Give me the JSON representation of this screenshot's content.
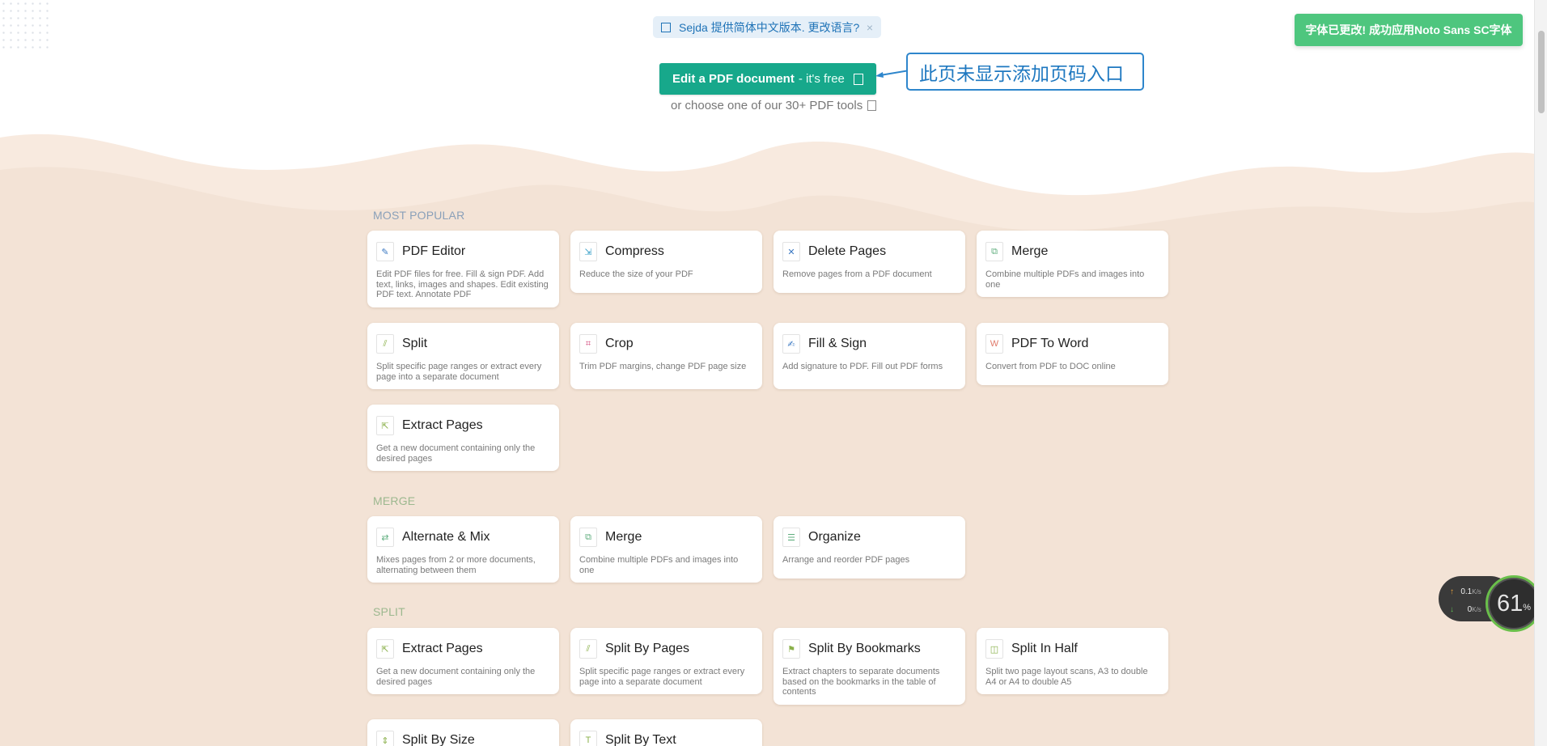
{
  "language_bar": {
    "text": "Sejda 提供简体中文版本. 更改语言?",
    "close": "×"
  },
  "toast": {
    "text": "字体已更改! 成功应用Noto Sans SC字体"
  },
  "hero": {
    "edit_button_bold": "Edit a PDF document",
    "edit_button_rest": "- it's free",
    "choose_text": "or choose one of our 30+ PDF tools"
  },
  "callout": {
    "text": "此页未显示添加页码入口"
  },
  "sections": {
    "popular": "MOST POPULAR",
    "merge": "MERGE",
    "split": "SPLIT"
  },
  "cards": {
    "pdf_editor": {
      "title": "PDF Editor",
      "desc": "Edit PDF files for free. Fill & sign PDF. Add text, links, images and shapes. Edit existing PDF text. Annotate PDF",
      "color": "#3a78c2"
    },
    "compress": {
      "title": "Compress",
      "desc": "Reduce the size of your PDF",
      "color": "#3aa0c8"
    },
    "delete_pages": {
      "title": "Delete Pages",
      "desc": "Remove pages from a PDF document",
      "color": "#3a78c2"
    },
    "merge": {
      "title": "Merge",
      "desc": "Combine multiple PDFs and images into one",
      "color": "#5fae7e"
    },
    "split": {
      "title": "Split",
      "desc": "Split specific page ranges or extract every page into a separate document",
      "color": "#8ab04a"
    },
    "crop": {
      "title": "Crop",
      "desc": "Trim PDF margins, change PDF page size",
      "color": "#d3467a"
    },
    "fill_sign": {
      "title": "Fill & Sign",
      "desc": "Add signature to PDF. Fill out PDF forms",
      "color": "#3a78c2"
    },
    "pdf_to_word": {
      "title": "PDF To Word",
      "desc": "Convert from PDF to DOC online",
      "color": "#e07a6a"
    },
    "extract_pages": {
      "title": "Extract Pages",
      "desc": "Get a new document containing only the desired pages",
      "color": "#8ab04a"
    },
    "alternate_mix": {
      "title": "Alternate & Mix",
      "desc": "Mixes pages from 2 or more documents, alternating between them",
      "color": "#5fae7e"
    },
    "merge2": {
      "title": "Merge",
      "desc": "Combine multiple PDFs and images into one",
      "color": "#5fae7e"
    },
    "organize": {
      "title": "Organize",
      "desc": "Arrange and reorder PDF pages",
      "color": "#5fae7e"
    },
    "extract_pages2": {
      "title": "Extract Pages",
      "desc": "Get a new document containing only the desired pages",
      "color": "#8ab04a"
    },
    "split_by_pages": {
      "title": "Split By Pages",
      "desc": "Split specific page ranges or extract every page into a separate document",
      "color": "#8ab04a"
    },
    "split_by_bookmarks": {
      "title": "Split By Bookmarks",
      "desc": "Extract chapters to separate documents based on the bookmarks in the table of contents",
      "color": "#8ab04a"
    },
    "split_in_half": {
      "title": "Split In Half",
      "desc": "Split two page layout scans, A3 to double A4 or A4 to double A5",
      "color": "#8ab04a"
    },
    "split_by_size": {
      "title": "Split By Size",
      "desc": "",
      "color": "#8ab04a"
    },
    "split_by_text": {
      "title": "Split By Text",
      "desc": "",
      "color": "#8ab04a"
    }
  },
  "speed_widget": {
    "up": "0.1",
    "up_unit": "K/s",
    "down": "0",
    "down_unit": "K/s",
    "percent": "61",
    "percent_sign": "%"
  }
}
